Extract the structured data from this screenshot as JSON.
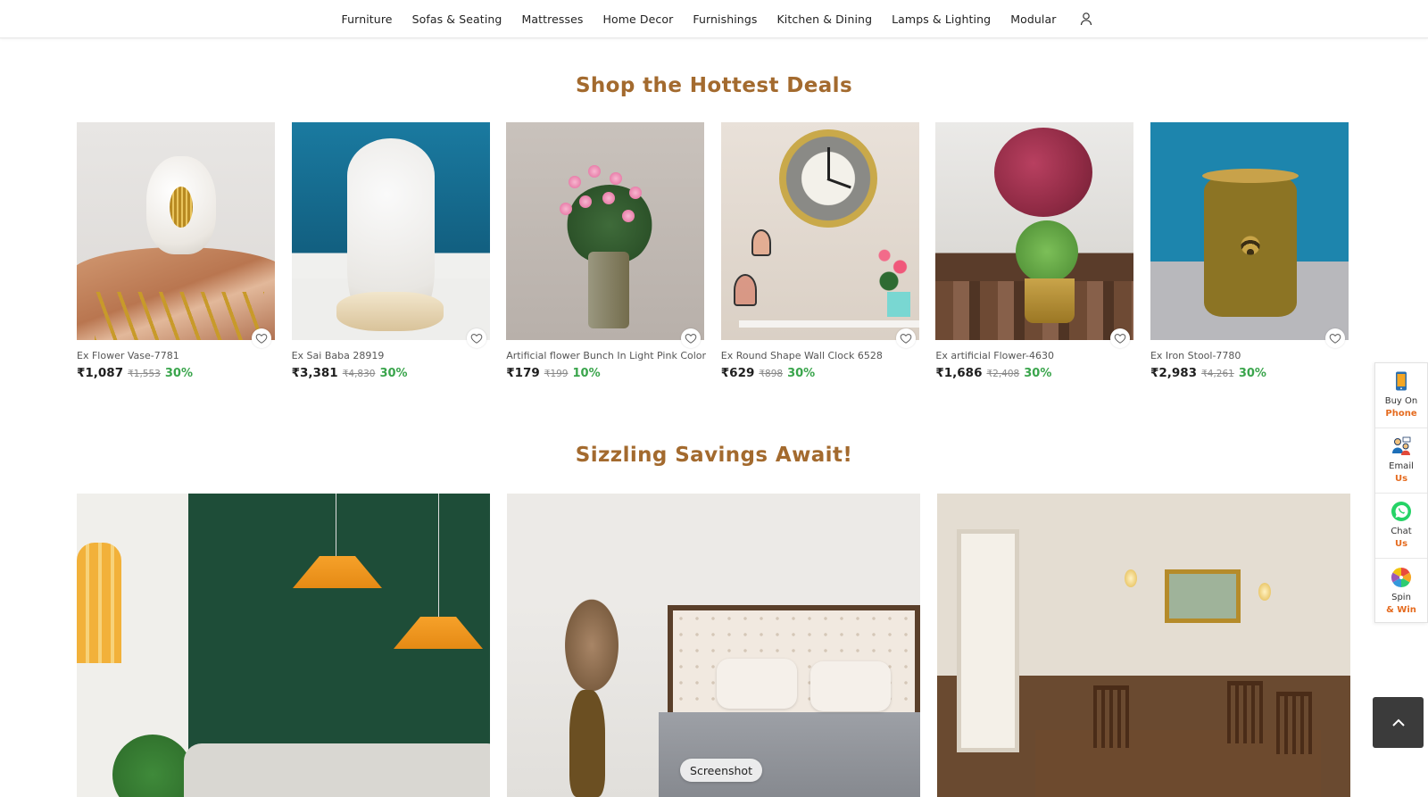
{
  "nav": {
    "items": [
      {
        "label": "Furniture"
      },
      {
        "label": "Sofas & Seating"
      },
      {
        "label": "Mattresses"
      },
      {
        "label": "Home Decor"
      },
      {
        "label": "Furnishings"
      },
      {
        "label": "Kitchen & Dining"
      },
      {
        "label": "Lamps & Lighting"
      },
      {
        "label": "Modular"
      }
    ],
    "user_icon": "user-icon"
  },
  "deals": {
    "title": "Shop the Hottest Deals",
    "products": [
      {
        "name": "Ex Flower Vase-7781",
        "price": "₹1,087",
        "mrp": "₹1,553",
        "discount": "30%"
      },
      {
        "name": "Ex Sai Baba 28919",
        "price": "₹3,381",
        "mrp": "₹4,830",
        "discount": "30%"
      },
      {
        "name": "Artificial flower Bunch In Light Pink Color",
        "price": "₹179",
        "mrp": "₹199",
        "discount": "10%"
      },
      {
        "name": "Ex Round Shape Wall Clock 6528",
        "price": "₹629",
        "mrp": "₹898",
        "discount": "30%"
      },
      {
        "name": "Ex artificial Flower-4630",
        "price": "₹1,686",
        "mrp": "₹2,408",
        "discount": "30%"
      },
      {
        "name": "Ex Iron Stool-7780",
        "price": "₹2,983",
        "mrp": "₹4,261",
        "discount": "30%"
      }
    ]
  },
  "savings": {
    "title": "Sizzling Savings Await!"
  },
  "float_widget": {
    "items": [
      {
        "line1": "Buy On",
        "line2": "Phone",
        "icon": "phone-icon"
      },
      {
        "line1": "Email",
        "line2": "Us",
        "icon": "email-support-icon"
      },
      {
        "line1": "Chat",
        "line2": "Us",
        "icon": "whatsapp-icon"
      },
      {
        "line1": "Spin",
        "line2": "& Win",
        "icon": "spin-wheel-icon"
      }
    ]
  },
  "tooltip": {
    "label": "Screenshot"
  },
  "colors": {
    "heading": "#a36a2e",
    "discount": "#3aa54c",
    "accent": "#e56b1f"
  }
}
